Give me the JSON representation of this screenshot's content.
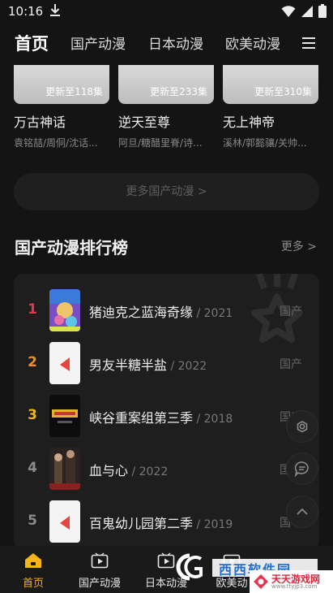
{
  "status": {
    "time": "10:16"
  },
  "nav": {
    "tabs": [
      {
        "label": "首页"
      },
      {
        "label": "国产动漫"
      },
      {
        "label": "日本动漫"
      },
      {
        "label": "欧美动漫"
      }
    ]
  },
  "cards": [
    {
      "episode": "更新至118集",
      "title": "万古神话",
      "cast": "袁铭喆/周侗/沈话..."
    },
    {
      "episode": "更新至233集",
      "title": "逆天至尊",
      "cast": "阿旦/糖醋里脊/诗..."
    },
    {
      "episode": "更新至310集",
      "title": "无上神帝",
      "cast": "溪林/郭懿骧/关帅..."
    }
  ],
  "more_button": "更多国产动漫 >",
  "ranking_section": {
    "title": "国产动漫排行榜",
    "more": "更多 >",
    "items": [
      {
        "rank": "1",
        "title": "猪迪克之蓝海奇缘",
        "year": " / 2021",
        "tag": "国产",
        "color": "#e8344e"
      },
      {
        "rank": "2",
        "title": "男友半糖半盐",
        "year": " / 2022",
        "tag": "国产",
        "color": "#f08c2a"
      },
      {
        "rank": "3",
        "title": "峡谷重案组第三季",
        "year": " / 2018",
        "tag": "国产",
        "color": "#f5b417"
      },
      {
        "rank": "4",
        "title": "血与心",
        "year": " / 2022",
        "tag": "国",
        "color": "#8a8a8a"
      },
      {
        "rank": "5",
        "title": "百鬼幼儿园第二季",
        "year": " / 2019",
        "tag": "国",
        "color": "#8a8a8a"
      }
    ]
  },
  "bottom_nav": [
    {
      "label": "首页",
      "icon": "home-icon"
    },
    {
      "label": "国产动漫",
      "icon": "play-icon"
    },
    {
      "label": "日本动漫",
      "icon": "play-icon"
    },
    {
      "label": "欧美动",
      "icon": "play-icon"
    }
  ],
  "watermark": {
    "text": "西西软件园",
    "site": "天天游戏网",
    "url": "www.ttyjp3.com"
  },
  "colors": {
    "accent": "#f5b417",
    "background": "#141414"
  }
}
